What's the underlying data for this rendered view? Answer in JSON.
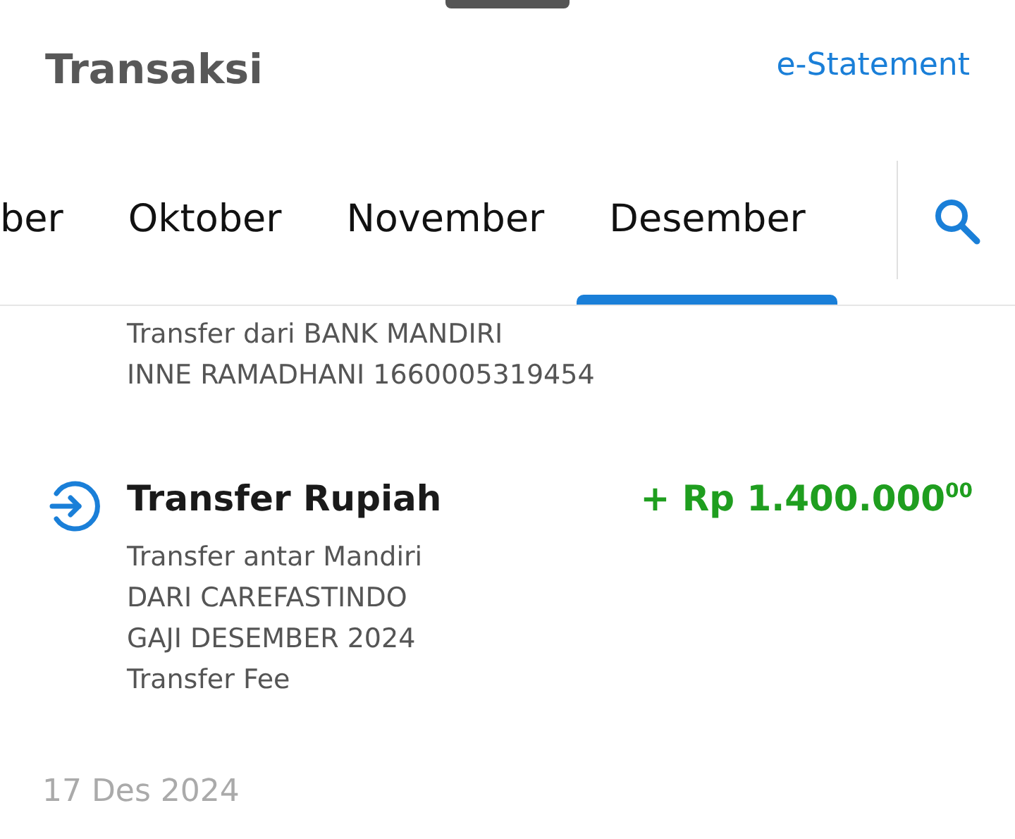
{
  "header": {
    "title": "Transaksi",
    "link": "e-Statement"
  },
  "tabs": [
    {
      "label": "ber",
      "selected": false
    },
    {
      "label": "Oktober",
      "selected": false
    },
    {
      "label": "November",
      "selected": false
    },
    {
      "label": "Desember",
      "selected": true
    }
  ],
  "transactions": [
    {
      "kind": "continued",
      "details": [
        "Transfer dari BANK MANDIRI",
        "INNE RAMADHANI 1660005319454"
      ]
    },
    {
      "kind": "full",
      "incoming": true,
      "title": "Transfer Rupiah",
      "amount": "+ Rp 1.400.000$^{00}$",
      "details": [
        "Transfer antar Mandiri",
        "DARI CAREFASTINDO",
        "GAJI DESEMBER 2024",
        "Transfer Fee"
      ]
    }
  ],
  "date_header": "17 Des 2024"
}
